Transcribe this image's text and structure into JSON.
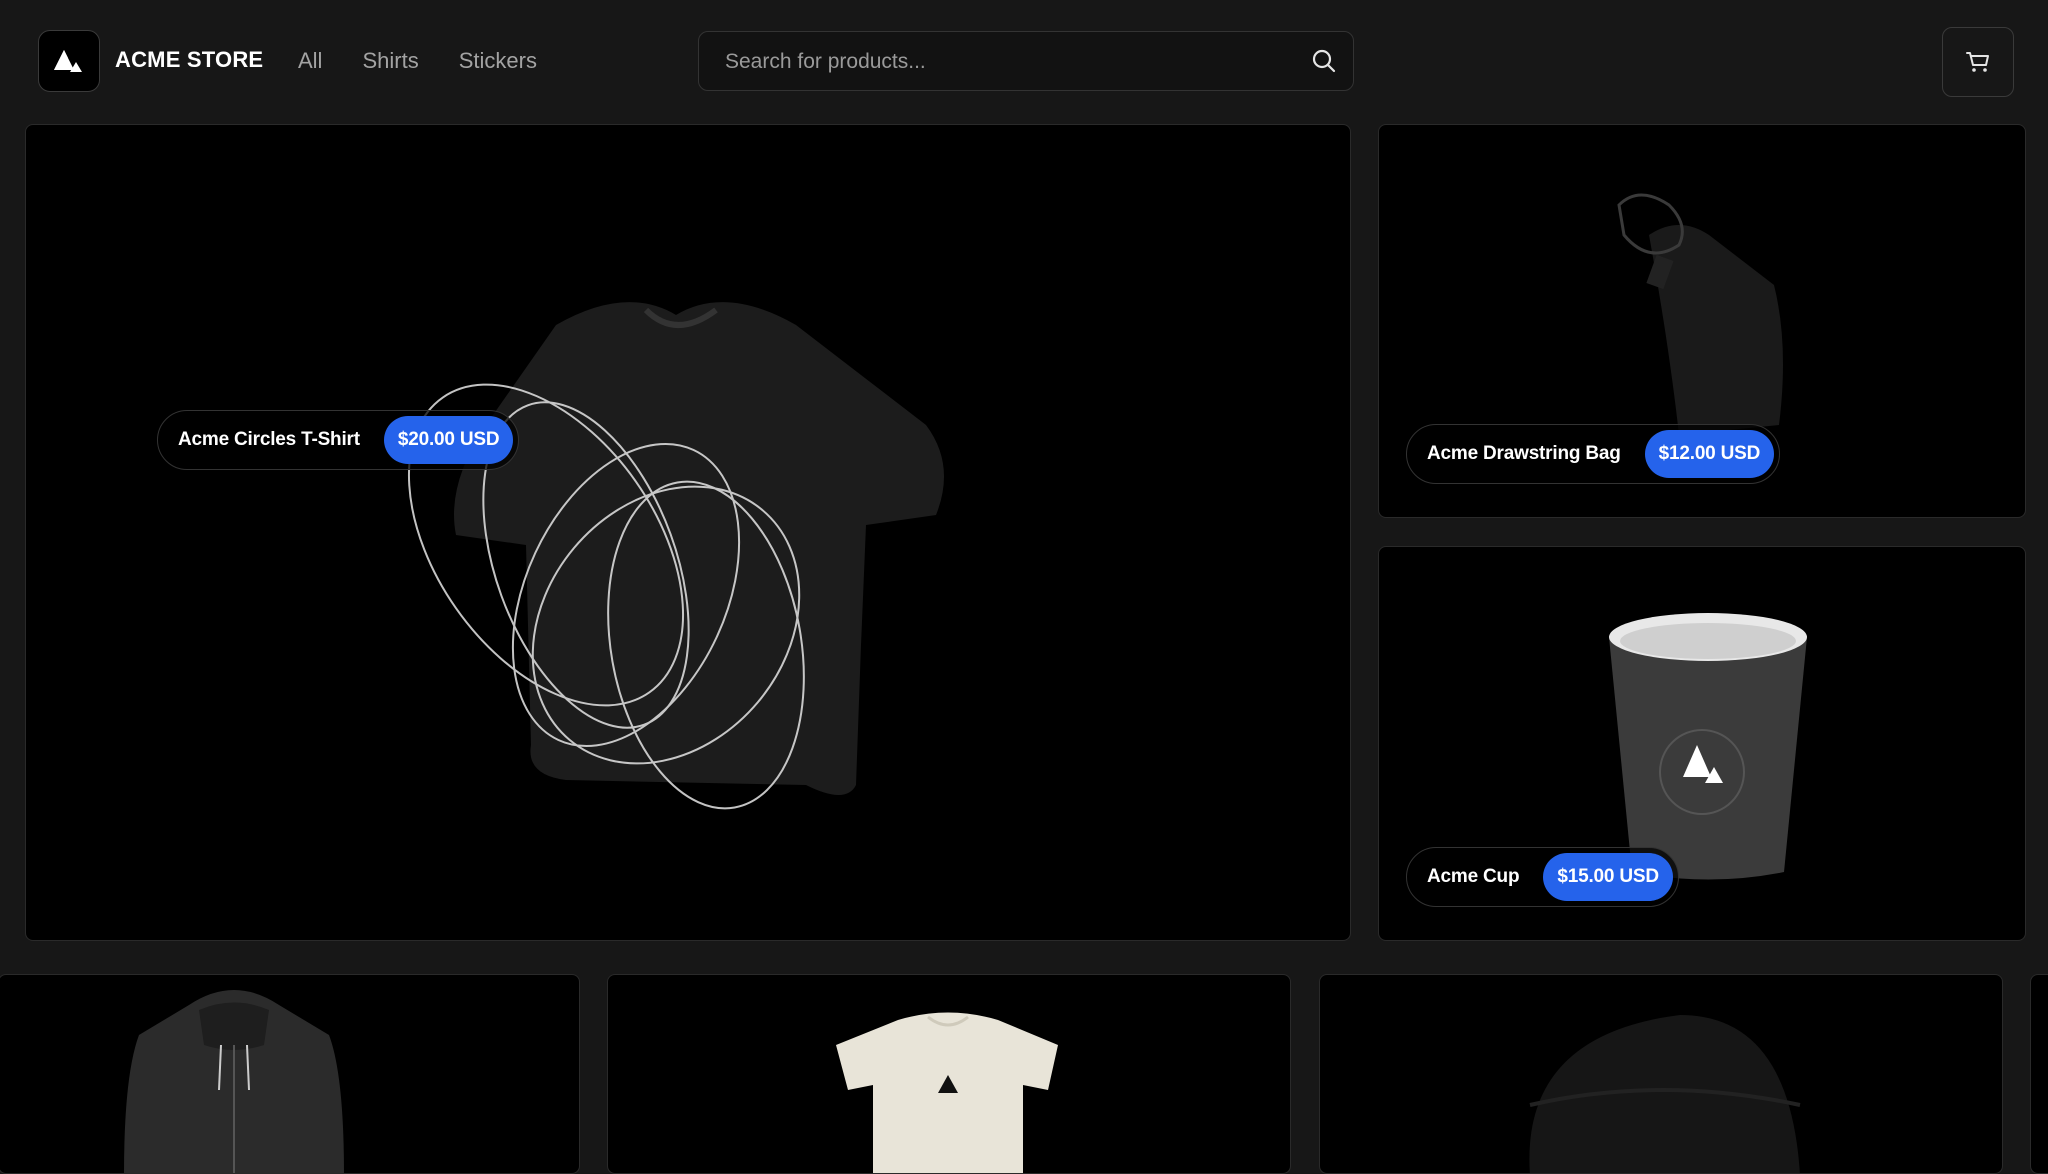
{
  "header": {
    "store_name": "ACME STORE",
    "nav": [
      {
        "label": "All"
      },
      {
        "label": "Shirts"
      },
      {
        "label": "Stickers"
      }
    ],
    "search": {
      "placeholder": "Search for products..."
    },
    "icons": {
      "search": "search-icon",
      "cart": "cart-icon",
      "logo": "acme-logo-icon"
    }
  },
  "featured": [
    {
      "name": "Acme Circles T-Shirt",
      "price": "$20.00 USD"
    },
    {
      "name": "Acme Drawstring Bag",
      "price": "$12.00 USD"
    },
    {
      "name": "Acme Cup",
      "price": "$15.00 USD"
    }
  ],
  "carousel": [
    {
      "image": "hoodie"
    },
    {
      "image": "baby-onesie"
    },
    {
      "image": "beanie"
    }
  ],
  "colors": {
    "background": "#171717",
    "price_badge": "#2563eb"
  }
}
